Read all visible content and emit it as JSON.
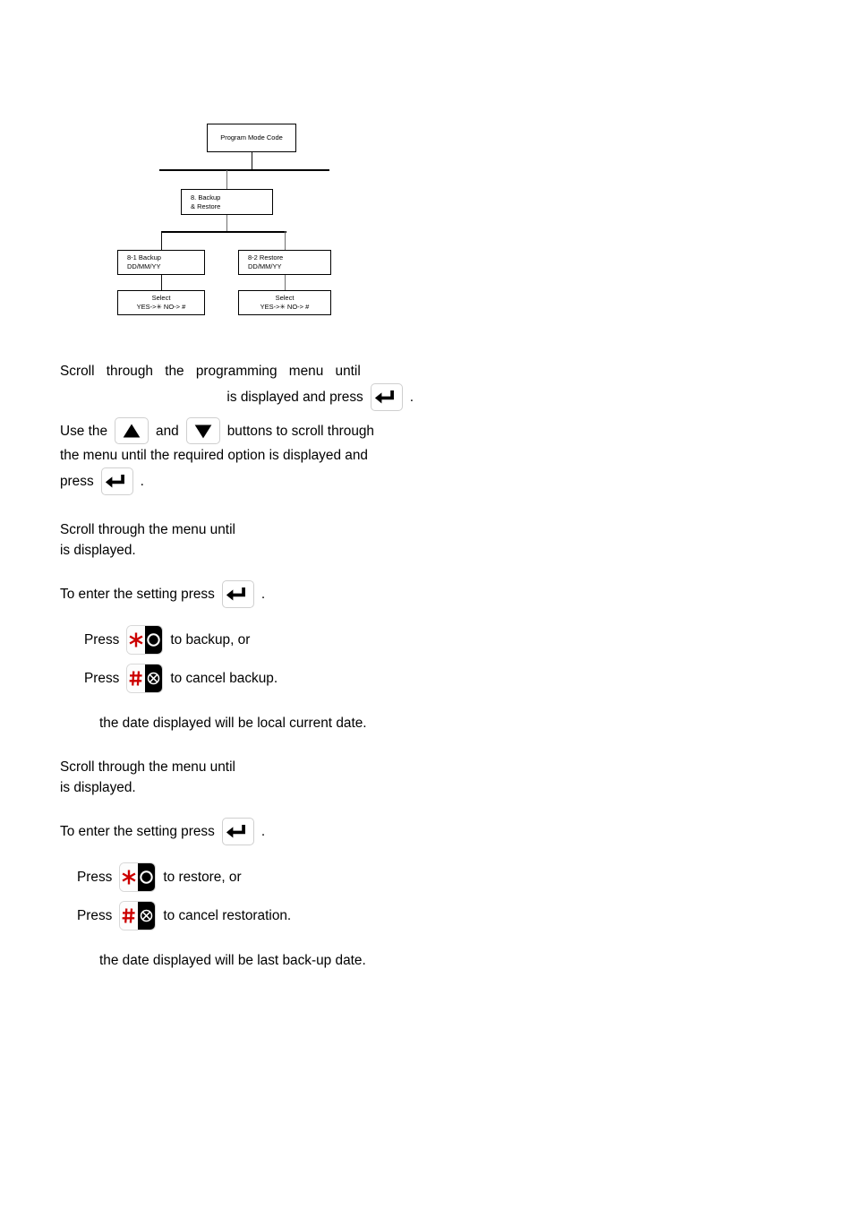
{
  "diagram": {
    "name": "backup-restore-menu-tree",
    "nodes": [
      {
        "id": "program-mode-code",
        "label": "Program Mode Code"
      },
      {
        "id": "backup-restore",
        "line1": "8. Backup",
        "line2": "& Restore"
      },
      {
        "id": "backup",
        "line1": "8-1 Backup",
        "line2": "DD/MM/YY"
      },
      {
        "id": "restore",
        "line1": "8-2 Restore",
        "line2": "DD/MM/YY"
      },
      {
        "id": "select-backup",
        "line1": "Select",
        "line2": "YES->✳   NO-> #"
      },
      {
        "id": "select-restore",
        "line1": "Select",
        "line2": "YES->✳     NO-> #"
      }
    ]
  },
  "intro": {
    "line1_a": "Scroll",
    "line1_b": "through",
    "line1_c": "the",
    "line1_d": "programming",
    "line1_e": "menu",
    "line1_f": "until",
    "line2_text": "is displayed and press",
    "line2_period": "."
  },
  "scroll_instruction": {
    "part1": "Use  the",
    "part2": "and",
    "part3": "buttons  to  scroll  through",
    "line2": "the   menu   until   the   required   option   is   displayed   and",
    "line3": "press",
    "period": "."
  },
  "backup_section": {
    "scroll_line1": "Scroll through the menu until",
    "scroll_line2": "is displayed.",
    "enter_line": "To enter the setting press",
    "enter_period": ".",
    "press_label_1": "Press",
    "press_action_1": "to backup, or",
    "press_label_2": "Press",
    "press_action_2": "to cancel backup.",
    "note": "the date displayed will be local current date."
  },
  "restore_section": {
    "scroll_line1": "Scroll through the menu until",
    "scroll_line2": "is displayed.",
    "enter_line": "To enter the setting press",
    "enter_period": ".",
    "press_label_1": "Press",
    "press_action_1": "to restore, or",
    "press_label_2": "Press",
    "press_action_2": "to cancel restoration.",
    "note": "the date displayed will be last back-up date."
  },
  "colors": {
    "ink": "#000000",
    "accent_red": "#cc0000",
    "paper": "#ffffff",
    "key_border": "#cfcfcf",
    "connector_gray": "#6f6f6f"
  }
}
